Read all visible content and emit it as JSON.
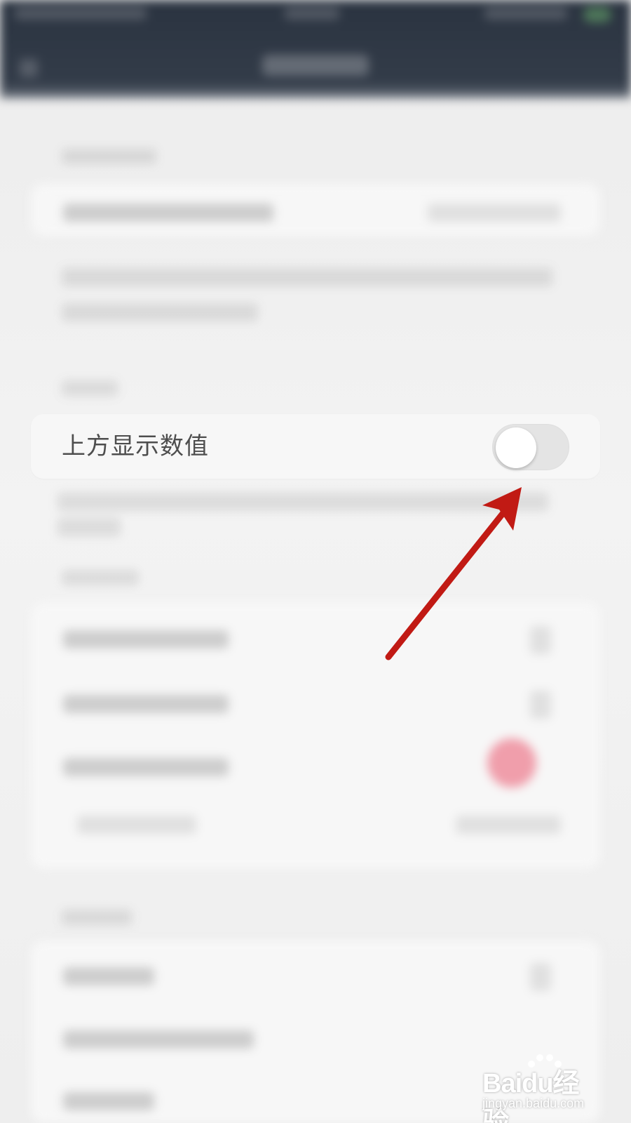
{
  "settings_row": {
    "label": "上方显示数值",
    "toggle_on": false
  },
  "annotation": {
    "arrow_color": "#c11a14"
  },
  "watermark": {
    "brand": "Baidu经验",
    "url": "jingyan.baidu.com"
  },
  "colors": {
    "navbar": "#2a3340",
    "card": "#f7f7f7",
    "toggle_track": "#e4e4e4",
    "blurred_red_badge": "#ec6e82"
  }
}
